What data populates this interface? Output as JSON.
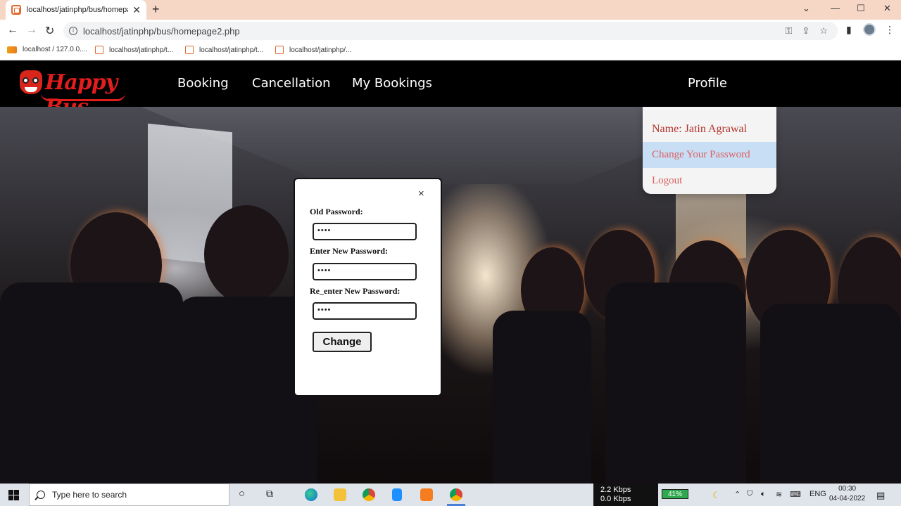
{
  "browser": {
    "tab_title": "localhost/jatinphp/bus/homepage",
    "new_tab": "+",
    "url": "localhost/jatinphp/bus/homepage2.php",
    "bookmarks": [
      {
        "label": "localhost / 127.0.0...."
      },
      {
        "label": "localhost/jatinphp/t..."
      },
      {
        "label": "localhost/jatinphp/t..."
      },
      {
        "label": "localhost/jatinphp/..."
      }
    ]
  },
  "site": {
    "logo_text": "Happy Bus",
    "nav": {
      "booking": "Booking",
      "cancellation": "Cancellation",
      "my_bookings": "My Bookings",
      "profile": "Profile"
    },
    "profile_menu": {
      "name": "Name: Jatin Agrawal",
      "change_password": "Change Your Password",
      "logout": "Logout"
    }
  },
  "modal": {
    "close": "×",
    "old_label": "Old Password:",
    "old_value": "••••",
    "new_label": "Enter New Password:",
    "new_value": "••••",
    "reenter_label": "Re_enter New Password:",
    "reenter_value": "••••",
    "submit": "Change"
  },
  "taskbar": {
    "search_placeholder": "Type here to search",
    "net_up": "2.2 Kbps",
    "net_down": "0.0 Kbps",
    "battery": "41%",
    "language": "ENG",
    "time": "00:30",
    "date": "04-04-2022"
  }
}
